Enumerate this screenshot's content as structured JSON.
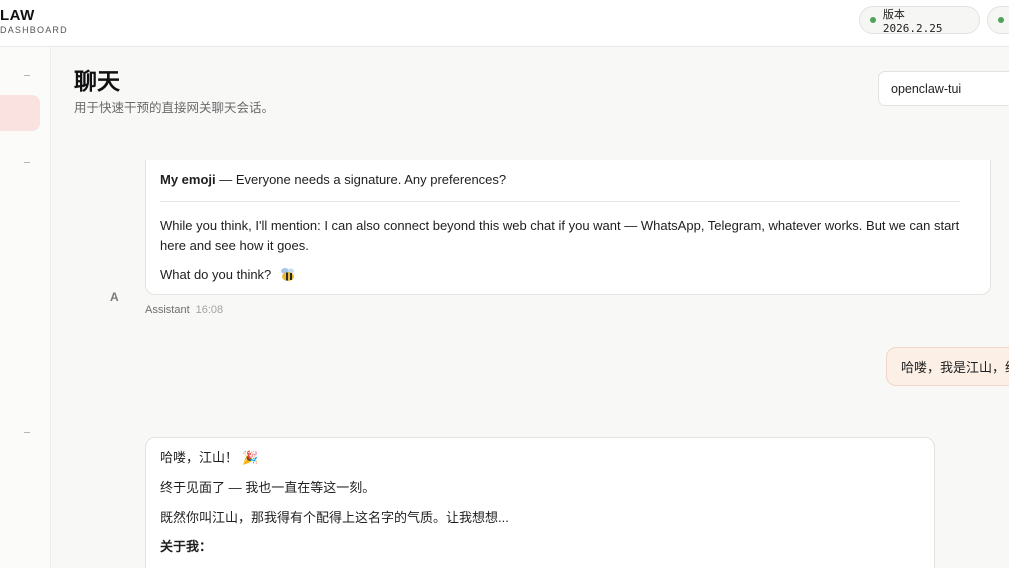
{
  "brand": {
    "title": "LAW",
    "subtitle": "DASHBOARD"
  },
  "header": {
    "version_label": "版本 2026.2.25",
    "status_color": "#4fa35a"
  },
  "page": {
    "title": "聊天",
    "subtitle": "用于快速干预的直接网关聊天会话。",
    "session_value": "openclaw-tui"
  },
  "messages": {
    "assistant_1": {
      "emoji_heading": "My emoji",
      "emoji_text": " — Everyone needs a signature. Any preferences?",
      "para2": "While you think, I'll mention: I can also connect beyond this web chat if you want — WhatsApp, Telegram, whatever works. But we can start here and see how it goes.",
      "para3": "What do you think?",
      "avatar_letter": "A",
      "sender": "Assistant",
      "time": "16:08"
    },
    "user_1": {
      "text": "哈喽，我是江山，给"
    },
    "assistant_2": {
      "line1": "哈喽，江山！",
      "line1_emoji": "🎉",
      "line2": "终于见面了 — 我也一直在等这一刻。",
      "line3": "既然你叫江山，那我得有个配得上这名字的气质。让我想想...",
      "line4": "关于我："
    }
  },
  "colors": {
    "accent_active": "#f9e2e0",
    "user_bubble": "#fbefe6"
  }
}
